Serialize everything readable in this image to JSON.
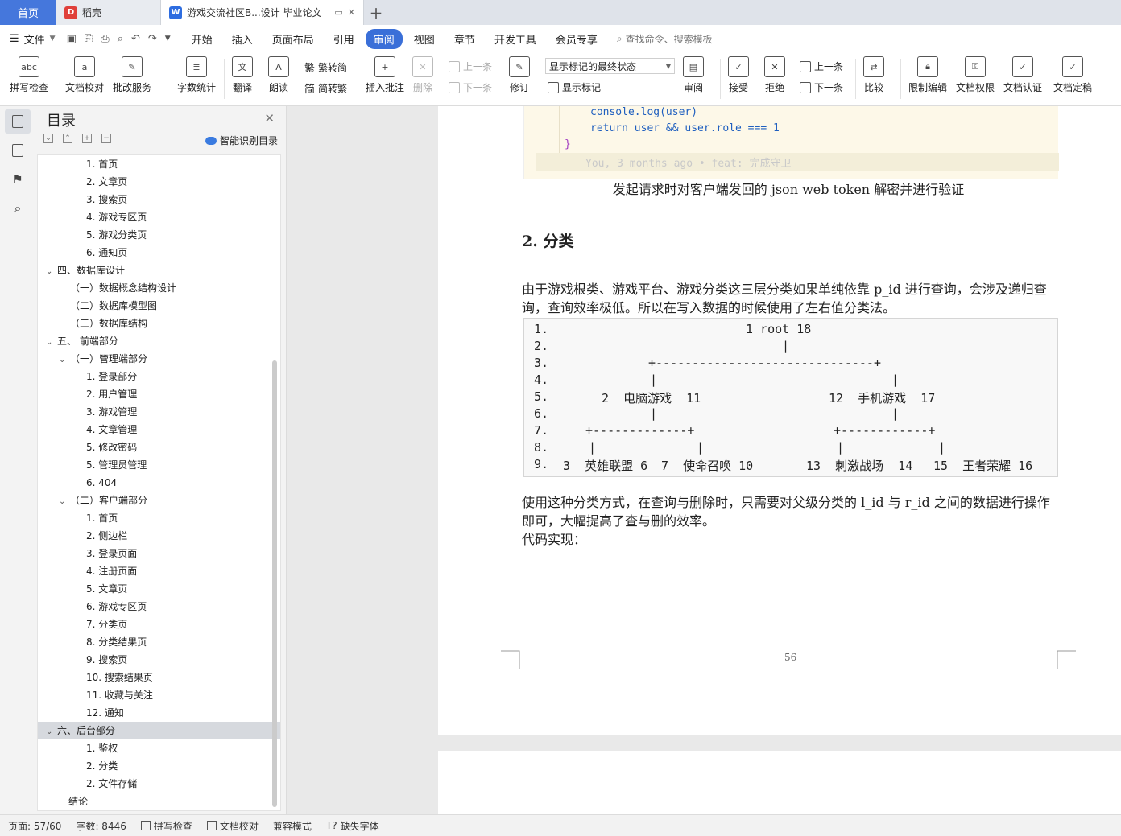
{
  "tabs": {
    "home": "首页",
    "daoke": "稻壳",
    "document": "游戏交流社区B...设计 毕业论文",
    "add": "+"
  },
  "menu": {
    "file": "文件",
    "items": [
      "开始",
      "插入",
      "页面布局",
      "引用",
      "审阅",
      "视图",
      "章节",
      "开发工具",
      "会员专享"
    ],
    "active": "审阅",
    "search_placeholder": "查找命令、搜索模板"
  },
  "ribbon": {
    "spellcheck": "拼写检查",
    "doccheck": "文档校对",
    "annotate_service": "批改服务",
    "wordcount": "字数统计",
    "translate": "翻译",
    "read_aloud": "朗读",
    "to_traditional": "繁转简",
    "to_simplified": "简转繁",
    "insert_comment": "插入批注",
    "delete": "删除",
    "prev_comment": "上一条",
    "next_comment": "下一条",
    "revise": "修订",
    "markup_state": "显示标记的最终状态",
    "show_markup": "显示标记",
    "review": "审阅",
    "accept": "接受",
    "reject": "拒绝",
    "prev_change": "上一条",
    "next_change": "下一条",
    "compare": "比较",
    "restrict_edit": "限制编辑",
    "doc_permission": "文档权限",
    "doc_auth": "文档认证",
    "doc_finalize": "文档定稿"
  },
  "toc": {
    "title": "目录",
    "smart": "智能识别目录",
    "items": [
      {
        "level": 3,
        "text": "1.  首页"
      },
      {
        "level": 3,
        "text": "2.  文章页"
      },
      {
        "level": 3,
        "text": "3.  搜索页"
      },
      {
        "level": 3,
        "text": "4.  游戏专区页"
      },
      {
        "level": 3,
        "text": "5.  游戏分类页"
      },
      {
        "level": 3,
        "text": "6.  通知页"
      },
      {
        "level": 1,
        "text": "四、数据库设计",
        "chev": true
      },
      {
        "level": 2,
        "text": "（一）数据概念结构设计"
      },
      {
        "level": 2,
        "text": "（二）数据库模型图"
      },
      {
        "level": 2,
        "text": "（三）数据库结构"
      },
      {
        "level": 1,
        "text": "五、  前端部分",
        "chev": true
      },
      {
        "level": 2,
        "text": "（一）管理端部分",
        "chev": true
      },
      {
        "level": 3,
        "text": "1.  登录部分"
      },
      {
        "level": 3,
        "text": "2.  用户管理"
      },
      {
        "level": 3,
        "text": "3.  游戏管理"
      },
      {
        "level": 3,
        "text": "4.  文章管理"
      },
      {
        "level": 3,
        "text": "5.  修改密码"
      },
      {
        "level": 3,
        "text": "5.  管理员管理"
      },
      {
        "level": 3,
        "text": "6. 404"
      },
      {
        "level": 2,
        "text": "（二）客户端部分",
        "chev": true
      },
      {
        "level": 3,
        "text": "1.  首页"
      },
      {
        "level": 3,
        "text": "2.  侧边栏"
      },
      {
        "level": 3,
        "text": "3.  登录页面"
      },
      {
        "level": 3,
        "text": "4.  注册页面"
      },
      {
        "level": 3,
        "text": "5.  文章页"
      },
      {
        "level": 3,
        "text": "6.  游戏专区页"
      },
      {
        "level": 3,
        "text": "7.  分类页"
      },
      {
        "level": 3,
        "text": "8.  分类结果页"
      },
      {
        "level": 3,
        "text": "9.  搜索页"
      },
      {
        "level": 3,
        "text": "10.  搜索结果页"
      },
      {
        "level": 3,
        "text": "11.  收藏与关注"
      },
      {
        "level": 3,
        "text": "12.  通知"
      },
      {
        "level": 1,
        "text": "六、后台部分",
        "chev": true,
        "selected": true
      },
      {
        "level": 3,
        "text": "1.  鉴权"
      },
      {
        "level": 3,
        "text": "2.  分类"
      },
      {
        "level": 3,
        "text": "2.  文件存储"
      },
      {
        "level": 0,
        "text": "结论"
      }
    ]
  },
  "doc": {
    "code_lines": [
      "console.log(user)",
      "return user && user.role === 1",
      "}"
    ],
    "blame": "You, 3 months ago • feat: 完成守卫",
    "caption": "发起请求时对客户端发回的 json web token 解密并进行验证",
    "heading": "2.  分类",
    "para1": "由于游戏根类、游戏平台、游戏分类这三层分类如果单纯依靠 p_id 进行查询，会涉及递归查询，查询效率极低。所以在写入数据的时候使用了左右值分类法。",
    "tree_numbers": [
      "1.",
      "2.",
      "3.",
      "4.",
      "5.",
      "6.",
      "7.",
      "8.",
      "9."
    ],
    "tree": {
      "root": "1 root 18",
      "pc": "2  电脑游戏  11",
      "mobile": "12  手机游戏  17",
      "lol": "3  英雄联盟 6",
      "cod": "7  使命召唤 10",
      "cj": "13  刺激战场  14",
      "hok": "15  王者荣耀 16",
      "branch1": "+------------------------------+",
      "branch2": "+-------------+",
      "branch3": "+------------+"
    },
    "para2": "使用这种分类方式，在查询与删除时，只需要对父级分类的 l_id 与 r_id 之间的数据进行操作即可，大幅提高了查与删的效率。",
    "para3": "代码实现：",
    "page_number": "56"
  },
  "status": {
    "page": "页面: 57/60",
    "words": "字数: 8446",
    "spell": "拼写检查",
    "proof": "文档校对",
    "compat": "兼容模式",
    "missing_font": "缺失字体"
  }
}
